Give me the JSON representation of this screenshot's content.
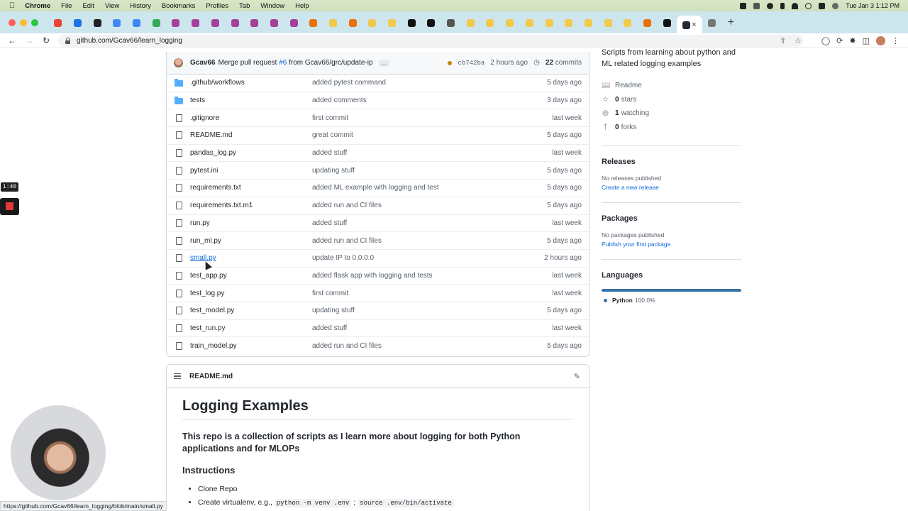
{
  "menubar": {
    "app": "Chrome",
    "items": [
      "File",
      "Edit",
      "View",
      "History",
      "Bookmarks",
      "Profiles",
      "Tab",
      "Window",
      "Help"
    ],
    "clock": "Tue Jan 3  1:12 PM"
  },
  "browser": {
    "url": "github.com/Gcav66/learn_logging",
    "tab_favicon_colors": [
      "#ea4335",
      "#1a73e8",
      "#202124",
      "#4285f4",
      "#4285f4",
      "#34a853",
      "#a4429b",
      "#a4429b",
      "#a4429b",
      "#a4429b",
      "#a4429b",
      "#a4429b",
      "#a4429b",
      "#e8710a",
      "#f2c94c",
      "#e8710a",
      "#f2c94c",
      "#f2c94c",
      "#111111",
      "#111111",
      "#555555",
      "#f2c94c",
      "#f2c94c",
      "#f2c94c",
      "#f2c94c",
      "#f2c94c",
      "#f2c94c",
      "#f2c94c",
      "#f2c94c",
      "#f2c94c",
      "#e8710a",
      "#111111",
      "#777777"
    ]
  },
  "repo": {
    "latest_commit": {
      "user": "Gcav66",
      "message_prefix": "Merge pull request",
      "pr": "#6",
      "message_suffix": "from Gcav66/grc/update-ip",
      "more": "…",
      "sha": "cb742ba",
      "time": "2 hours ago",
      "commit_count": "22",
      "commit_label": "commits"
    },
    "files": [
      {
        "name": ".github/workflows",
        "type": "folder",
        "message": "added pytest command",
        "age": "5 days ago"
      },
      {
        "name": "tests",
        "type": "folder",
        "message": "added comments",
        "age": "3 days ago"
      },
      {
        "name": ".gitignore",
        "type": "file",
        "message": "first commit",
        "age": "last week"
      },
      {
        "name": "README.md",
        "type": "file",
        "message": "great commit",
        "age": "5 days ago"
      },
      {
        "name": "pandas_log.py",
        "type": "file",
        "message": "added stuff",
        "age": "last week"
      },
      {
        "name": "pytest.ini",
        "type": "file",
        "message": "updating stuff",
        "age": "5 days ago"
      },
      {
        "name": "requirements.txt",
        "type": "file",
        "message": "added ML example with logging and test",
        "age": "5 days ago"
      },
      {
        "name": "requirements.txt.m1",
        "type": "file",
        "message": "added run and CI files",
        "age": "5 days ago"
      },
      {
        "name": "run.py",
        "type": "file",
        "message": "added stuff",
        "age": "last week"
      },
      {
        "name": "run_ml.py",
        "type": "file",
        "message": "added run and CI files",
        "age": "5 days ago"
      },
      {
        "name": "small.py",
        "type": "file",
        "message": "update IP to 0.0.0.0",
        "age": "2 hours ago"
      },
      {
        "name": "test_app.py",
        "type": "file",
        "message": "added flask app with logging and tests",
        "age": "last week"
      },
      {
        "name": "test_log.py",
        "type": "file",
        "message": "first commit",
        "age": "last week"
      },
      {
        "name": "test_model.py",
        "type": "file",
        "message": "updating stuff",
        "age": "5 days ago"
      },
      {
        "name": "test_run.py",
        "type": "file",
        "message": "added stuff",
        "age": "last week"
      },
      {
        "name": "train_model.py",
        "type": "file",
        "message": "added run and CI files",
        "age": "5 days ago"
      }
    ],
    "hovered_file": "small.py"
  },
  "readme": {
    "filename": "README.md",
    "title": "Logging Examples",
    "intro": "This repo is a collection of scripts as I learn more about logging for both Python applications and for MLOPs",
    "instructions_heading": "Instructions",
    "step1": "Clone Repo",
    "step2_text": "Create virtualenv, e.g.,",
    "step2_code1": "python -m venv .env",
    "step2_sep": ";",
    "step2_code2": "source .env/bin/activate"
  },
  "sidebar": {
    "about": "Scripts from learning about python and ML related logging examples",
    "readme_label": "Readme",
    "stars_count": "0",
    "stars_label": "stars",
    "watching_count": "1",
    "watching_label": "watching",
    "forks_count": "0",
    "forks_label": "forks",
    "releases_heading": "Releases",
    "releases_none": "No releases published",
    "releases_link": "Create a new release",
    "packages_heading": "Packages",
    "packages_none": "No packages published",
    "packages_link": "Publish your first package",
    "languages_heading": "Languages",
    "language_name": "Python",
    "language_percent": "100.0%",
    "language_share": 1.0,
    "language_color": "#3572a5"
  },
  "overlay": {
    "timer": "1:40",
    "status_url": "https://github.com/Gcav66/learn_logging/blob/main/small.py"
  }
}
